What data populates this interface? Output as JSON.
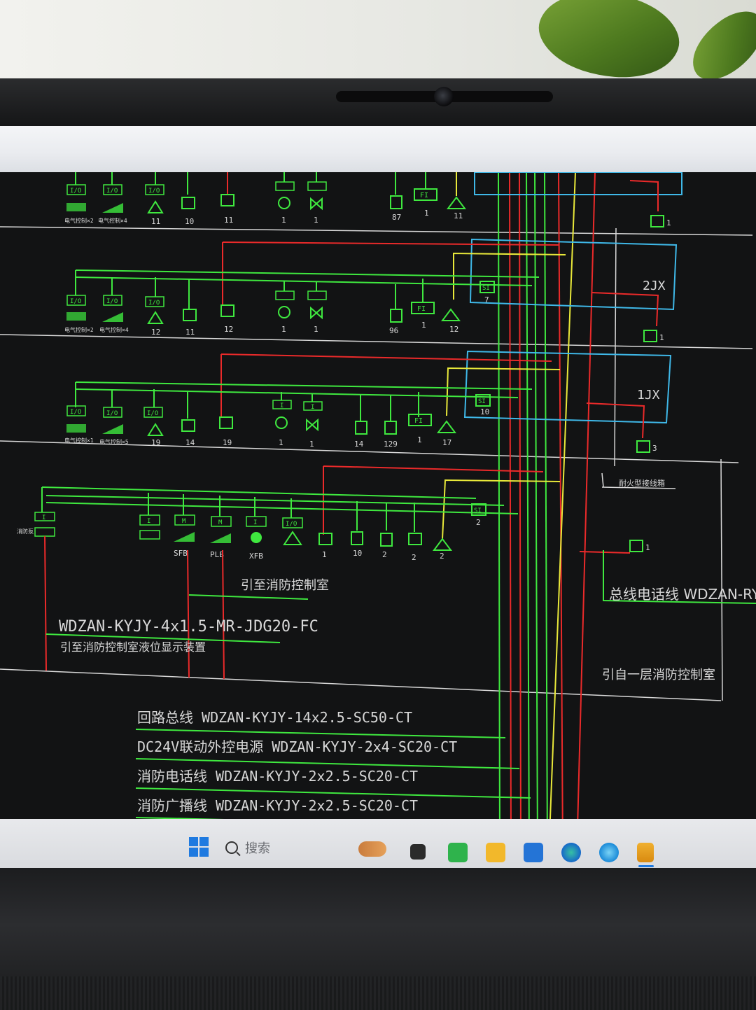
{
  "cad": {
    "panels": {
      "p2": "2JX",
      "p1": "1JX"
    },
    "device_labels": {
      "io": "I/O",
      "i": "I",
      "m": "M",
      "si": "SI",
      "fi": "FI",
      "row1_counts": [
        "11",
        "10",
        "11",
        "1",
        "1",
        "87",
        "1",
        "11"
      ],
      "row1_symbol_labels": [
        "电气控制×2",
        "电气控制×4"
      ],
      "row2_counts": [
        "12",
        "11",
        "12",
        "1",
        "1",
        "96",
        "1",
        "12",
        "7"
      ],
      "row2_symbol_labels": [
        "电气控制×2",
        "电气控制×4"
      ],
      "row3_counts": [
        "19",
        "14",
        "19",
        "1",
        "1",
        "14",
        "129",
        "1",
        "17",
        "10"
      ],
      "row3_symbol_labels": [
        "电气控制×1",
        "电气控制×5"
      ],
      "row4_counts": [
        "1",
        "10",
        "2",
        "2",
        "2",
        "2"
      ],
      "row4_labels": [
        "SFB",
        "PLB",
        "XFB"
      ],
      "phone_count_1": "1",
      "phone_count_2": "1",
      "phone_count_3": "3",
      "phone_count_4": "1",
      "left_box_label": "消防泵"
    },
    "annotations": {
      "to_fire_control": "引至消防控制室",
      "cable_spec": "WDZAN-KYJY-4x1.5-MR-JDG20-FC",
      "cable_note": "引至消防控制室液位显示装置",
      "fire_trunk_label": "耐火型接线箱",
      "bus_phone_line": "总线电话线 WDZAN-RYJS-",
      "from_control_room": "引自一层消防控制室"
    },
    "legend": {
      "l1": "回路总线 WDZAN-KYJY-14x2.5-SC50-CT",
      "l2": "DC24V联动外控电源 WDZAN-KYJY-2x4-SC20-CT",
      "l3": "消防电话线 WDZAN-KYJY-2x2.5-SC20-CT",
      "l4": "消防广播线 WDZAN-KYJY-2x2.5-SC20-CT"
    },
    "colors": {
      "green": "#3fe83f",
      "red": "#ea2a2a",
      "yellow": "#e8e83a",
      "cyan": "#3fb8e8",
      "white": "#d8d8d8"
    }
  },
  "taskbar": {
    "search_placeholder": "搜索",
    "apps": [
      "start-icon",
      "search-icon",
      "widgets-icon",
      "terminal-icon",
      "chat-icon",
      "folder-icon",
      "mail-icon",
      "edge-icon",
      "ie-icon",
      "app-icon"
    ]
  }
}
